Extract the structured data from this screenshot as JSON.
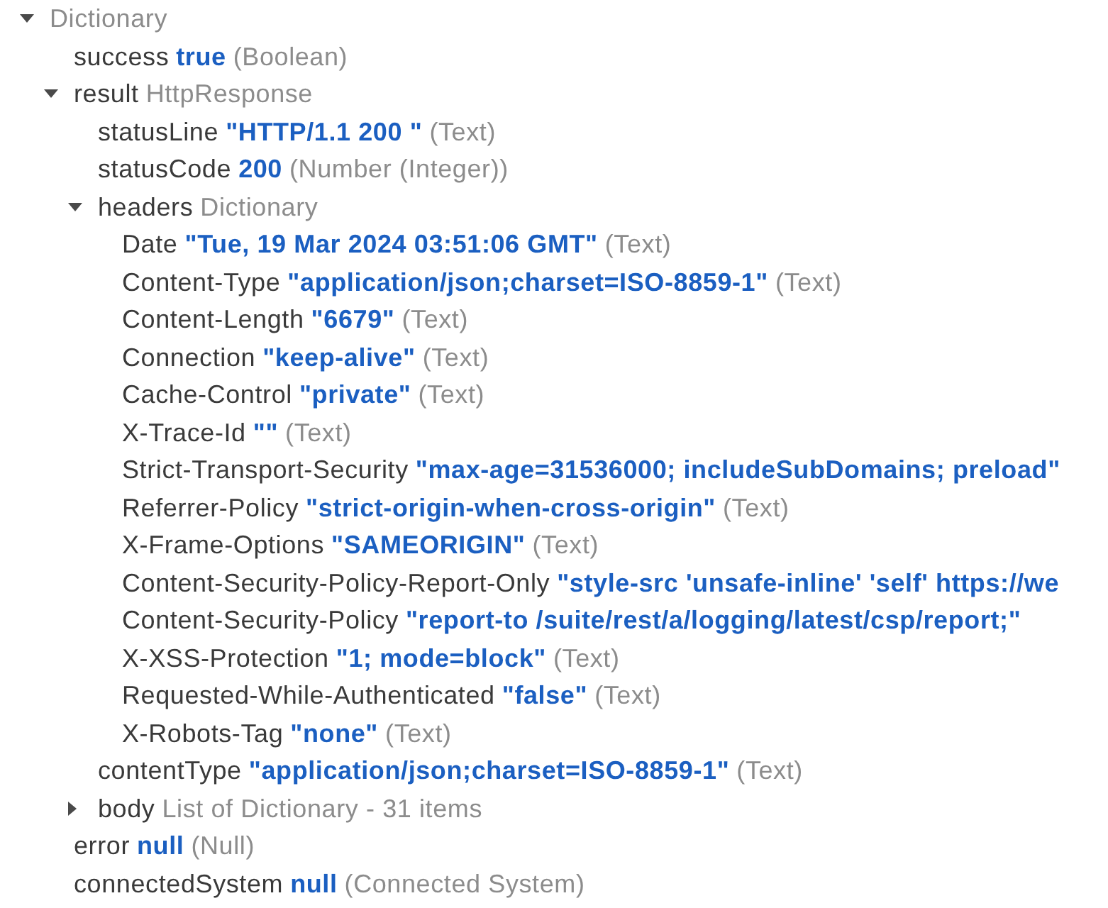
{
  "tree": {
    "type": "Dictionary",
    "expanded": true,
    "children": [
      {
        "key": "success",
        "value": "true",
        "type": "(Boolean)"
      },
      {
        "key": "result",
        "type": "HttpResponse",
        "expanded": true,
        "children": [
          {
            "key": "statusLine",
            "value": "\"HTTP/1.1 200 \"",
            "type": "(Text)"
          },
          {
            "key": "statusCode",
            "value": "200",
            "type": "(Number (Integer))"
          },
          {
            "key": "headers",
            "type": "Dictionary",
            "expanded": true,
            "children": [
              {
                "key": "Date",
                "value": "\"Tue, 19 Mar 2024 03:51:06 GMT\"",
                "type": "(Text)"
              },
              {
                "key": "Content-Type",
                "value": "\"application/json;charset=ISO-8859-1\"",
                "type": "(Text)"
              },
              {
                "key": "Content-Length",
                "value": "\"6679\"",
                "type": "(Text)"
              },
              {
                "key": "Connection",
                "value": "\"keep-alive\"",
                "type": "(Text)"
              },
              {
                "key": "Cache-Control",
                "value": "\"private\"",
                "type": "(Text)"
              },
              {
                "key": "X-Trace-Id",
                "value": "\"\"",
                "type": "(Text)"
              },
              {
                "key": "Strict-Transport-Security",
                "value": "\"max-age=31536000; includeSubDomains; preload\""
              },
              {
                "key": "Referrer-Policy",
                "value": "\"strict-origin-when-cross-origin\"",
                "type": "(Text)"
              },
              {
                "key": "X-Frame-Options",
                "value": "\"SAMEORIGIN\"",
                "type": "(Text)"
              },
              {
                "key": "Content-Security-Policy-Report-Only",
                "value": "\"style-src 'unsafe-inline' 'self' https://we"
              },
              {
                "key": "Content-Security-Policy",
                "value": "\"report-to /suite/rest/a/logging/latest/csp/report;\""
              },
              {
                "key": "X-XSS-Protection",
                "value": "\"1; mode=block\"",
                "type": "(Text)"
              },
              {
                "key": "Requested-While-Authenticated",
                "value": "\"false\"",
                "type": "(Text)"
              },
              {
                "key": "X-Robots-Tag",
                "value": "\"none\"",
                "type": "(Text)"
              }
            ]
          },
          {
            "key": "contentType",
            "value": "\"application/json;charset=ISO-8859-1\"",
            "type": "(Text)"
          },
          {
            "key": "body",
            "type": "List of Dictionary - 31 items",
            "expanded": false
          }
        ]
      },
      {
        "key": "error",
        "value": "null",
        "type": "(Null)"
      },
      {
        "key": "connectedSystem",
        "value": "null",
        "type": "(Connected System)"
      }
    ]
  }
}
